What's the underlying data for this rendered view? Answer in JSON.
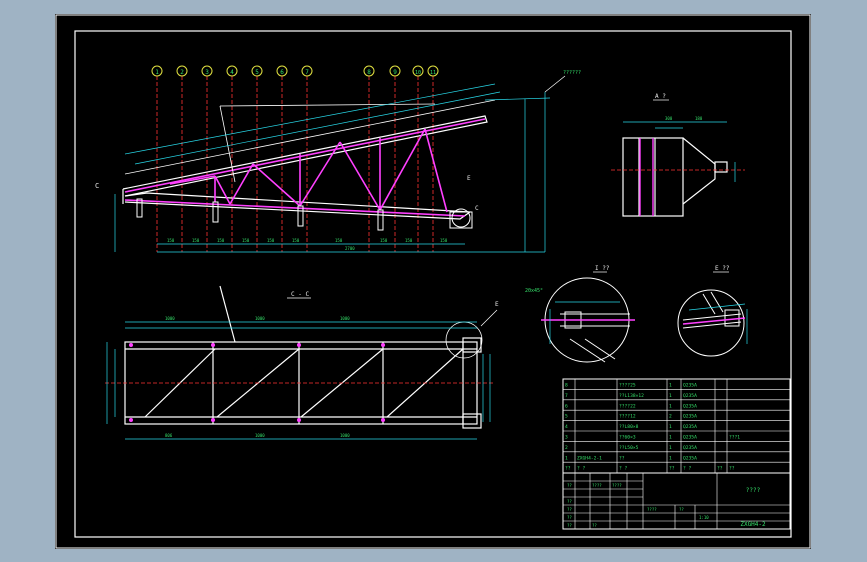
{
  "drawing": {
    "bubbles": [
      "1",
      "2",
      "3",
      "4",
      "5",
      "6",
      "7",
      "8",
      "9",
      "10",
      "11"
    ],
    "callout_top": "??????",
    "section_aa_title": "A ?",
    "section_cc_title": "C - C",
    "detail_b_title": "I ??",
    "detail_e_title": "E ??",
    "chamfer_label": "20x45°",
    "label_c_left": "C",
    "label_c_right": "C",
    "label_e_main": "E",
    "label_e_plan": "E"
  },
  "bom": {
    "rows": [
      {
        "no": "8",
        "code": "",
        "name": "????25",
        "qty": "1",
        "material": "Q235A",
        "note": ""
      },
      {
        "no": "7",
        "code": "",
        "name": "??L138×12",
        "qty": "1",
        "material": "Q235A",
        "note": ""
      },
      {
        "no": "6",
        "code": "",
        "name": "????22",
        "qty": "1",
        "material": "Q235A",
        "note": ""
      },
      {
        "no": "5",
        "code": "",
        "name": "????12",
        "qty": "2",
        "material": "Q235A",
        "note": ""
      },
      {
        "no": "4",
        "code": "",
        "name": "??L80×8",
        "qty": "1",
        "material": "Q235A",
        "note": ""
      },
      {
        "no": "3",
        "code": "",
        "name": "??60×3",
        "qty": "1",
        "material": "Q235A",
        "note": "???1"
      },
      {
        "no": "2",
        "code": "",
        "name": "??L50×5",
        "qty": "1",
        "material": "Q235A",
        "note": ""
      },
      {
        "no": "1",
        "code": "ZXGH4-2-1",
        "name": "??",
        "qty": "1",
        "material": "Q235A",
        "note": ""
      }
    ],
    "header": {
      "no": "??",
      "code": "? ?",
      "name": "? ?",
      "qty": "??",
      "material": "? ?",
      "weight": "??",
      "note": "??"
    }
  },
  "title_block": {
    "title": "????",
    "drawing_no": "ZXGH4-2",
    "cells": [
      "??",
      "????",
      "????",
      "??",
      "??",
      "??",
      "????",
      "??",
      "1:10",
      "??",
      "??"
    ]
  }
}
